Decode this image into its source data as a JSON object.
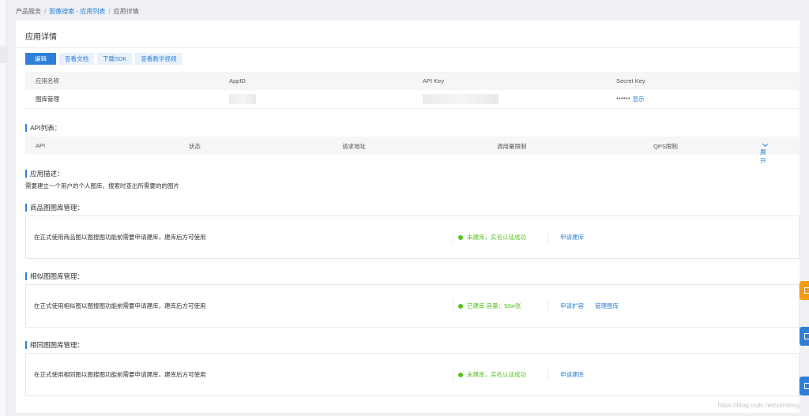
{
  "breadcrumb": {
    "items": [
      "产品服务",
      "图像搜索 - 应用列表",
      "应用详情"
    ],
    "separator": "/"
  },
  "page_title": "应用详情",
  "actions": {
    "edit": "编辑",
    "docs": "查看文档",
    "sdk": "下载SDK",
    "video": "查看教学视频"
  },
  "app_table": {
    "headers": [
      "应用名称",
      "AppID",
      "API Key",
      "Secret Key"
    ],
    "row": {
      "name": "图库管理",
      "secret_mask": "******",
      "show_label": "显示"
    }
  },
  "api_list": {
    "title": "API列表：",
    "headers": [
      "API",
      "状态",
      "请求地址",
      "调用量限制",
      "QPS限制"
    ],
    "expand_label": "展开"
  },
  "app_desc": {
    "title": "应用描述：",
    "text": "需要建立一个用户的个人图库，搜索时查出所需要的的图片"
  },
  "libraries": [
    {
      "title": "商品图图库管理：",
      "desc": "在正式使用商品图以图搜图功能前需要申请建库，建库后方可使用",
      "status": "未建库，实名认证成功",
      "links": [
        "申请建库"
      ]
    },
    {
      "title": "相似图图库管理：",
      "desc": "在正式使用相似图以图搜图功能前需要申请建库，建库后方可使用",
      "status": "已建库 容量：50w张",
      "links": [
        "申请扩容",
        "管理图库"
      ]
    },
    {
      "title": "相同图图库管理：",
      "desc": "在正式使用相同图以图搜图功能前需要申请建库，建库后方可使用",
      "status": "未建库，实名认证成功",
      "links": [
        "申请建库"
      ]
    }
  ],
  "status_color": "#52c41a",
  "accent_color": "#2d7fd8",
  "watermark": "https://blog.csdn.net/xdmincg"
}
